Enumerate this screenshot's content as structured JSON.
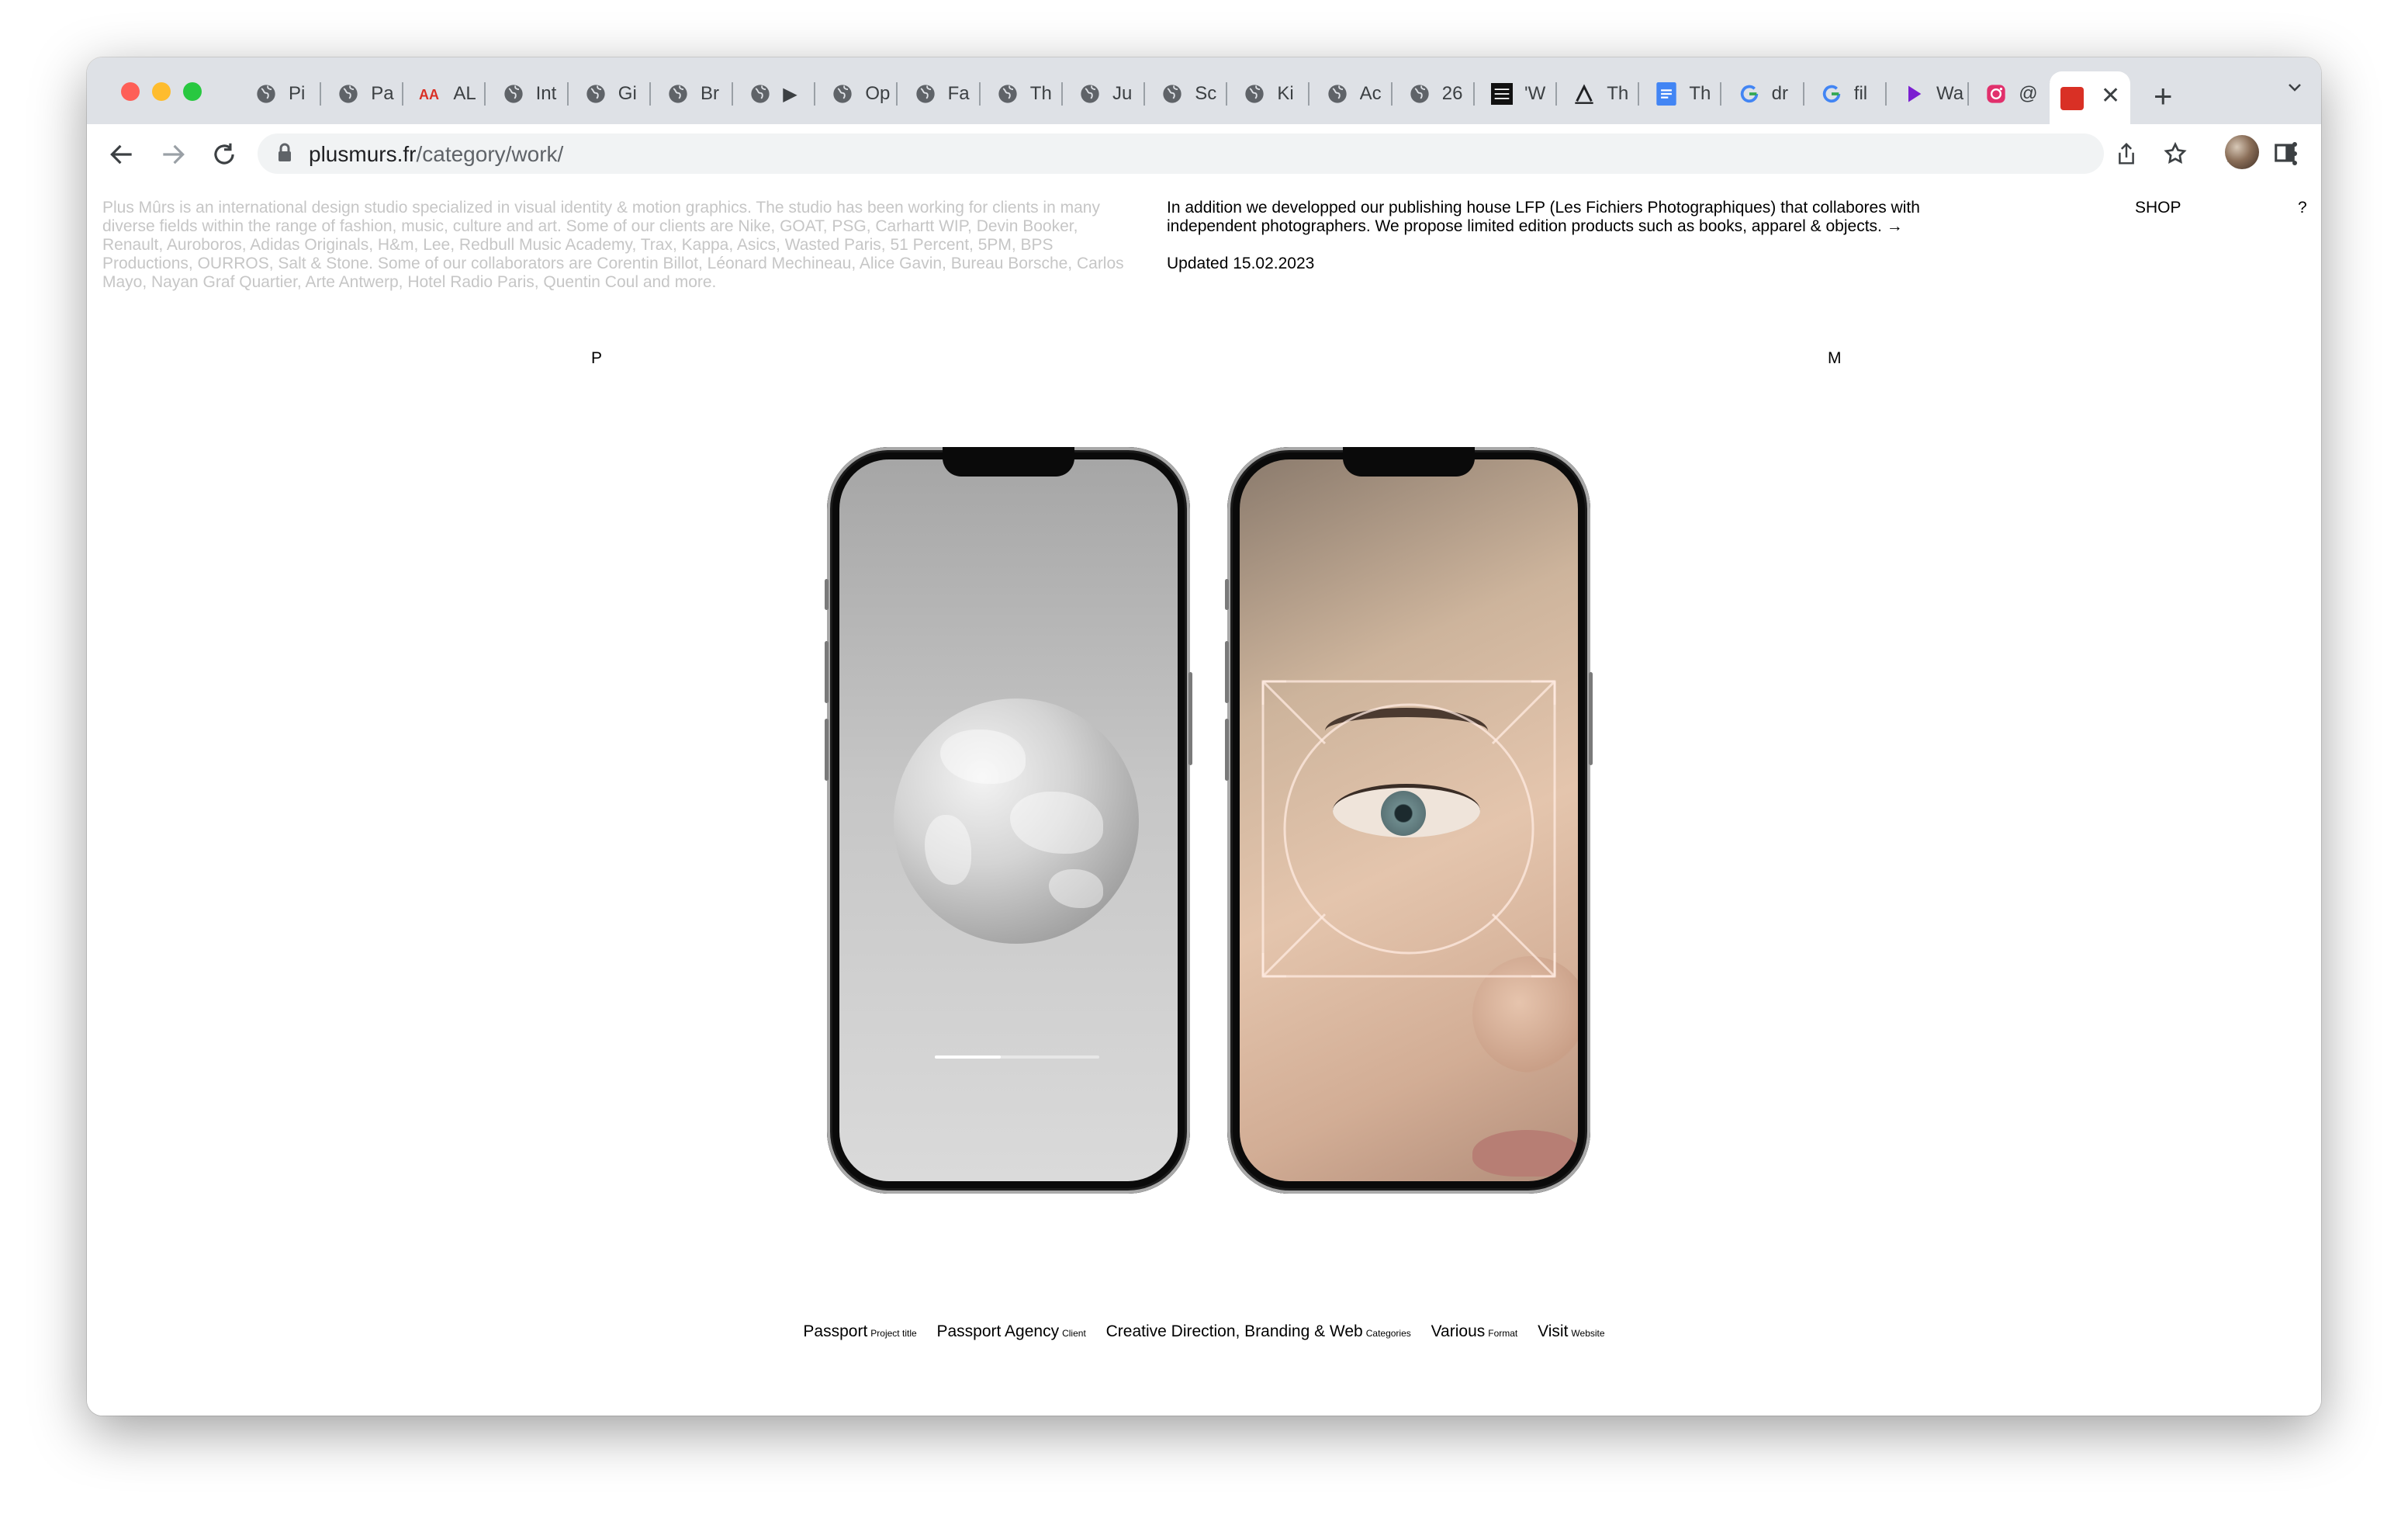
{
  "browser": {
    "tabs": [
      {
        "title": "Pi",
        "icon": "globe-icon"
      },
      {
        "title": "Pa",
        "icon": "globe-icon"
      },
      {
        "title": "AL",
        "icon": "aa-logo-icon"
      },
      {
        "title": "Int",
        "icon": "globe-icon"
      },
      {
        "title": "Gi",
        "icon": "globe-icon"
      },
      {
        "title": "Br",
        "icon": "globe-icon"
      },
      {
        "title": "▶",
        "icon": "globe-icon"
      },
      {
        "title": "Op",
        "icon": "globe-icon"
      },
      {
        "title": "Fa",
        "icon": "globe-icon"
      },
      {
        "title": "Th",
        "icon": "globe-icon"
      },
      {
        "title": "Ju",
        "icon": "globe-icon"
      },
      {
        "title": "Sc",
        "icon": "globe-icon"
      },
      {
        "title": "Ki",
        "icon": "globe-icon"
      },
      {
        "title": "Ac",
        "icon": "globe-icon"
      },
      {
        "title": "26",
        "icon": "globe-icon"
      },
      {
        "title": "'W",
        "icon": "sixth-tone-icon"
      },
      {
        "title": "Th",
        "icon": "a-logo-icon"
      },
      {
        "title": "Th",
        "icon": "google-docs-icon"
      },
      {
        "title": "dr",
        "icon": "google-icon"
      },
      {
        "title": "fil",
        "icon": "google-icon"
      },
      {
        "title": "Wa",
        "icon": "play-icon"
      },
      {
        "title": "@",
        "icon": "instagram-icon"
      }
    ],
    "active_tab": {
      "icon": "red-flag-icon",
      "close": "✕"
    },
    "new_tab": "+",
    "url_host": "plusmurs.fr",
    "url_path": "/category/work/"
  },
  "page": {
    "intro": "Plus Mûrs is an international design studio specialized in visual identity & motion graphics. The studio has been working for clients in many diverse fields within the range of fashion, music, culture and art. Some of our clients are Nike, GOAT, PSG, Carhartt WIP, Devin Booker, Renault, Auroboros, Adidas Originals, H&m, Lee, Redbull Music Academy, Trax, Kappa, Asics, Wasted Paris, 51 Percent, 5PM, BPS Productions, OURROS, Salt & Stone. Some of our collaborators are Corentin Billot, Léonard Mechineau, Alice Gavin, Bureau Borsche, Carlos Mayo, Nayan Graf Quartier, Arte Antwerp, Hotel Radio Paris, Quentin Coul and more.",
    "publishing": "In addition we developped our publishing house LFP (Les Fichiers Photographiques) that collabores with independent photographers. We propose limited edition products such as books, apparel & objects. →",
    "updated": "Updated 15.02.2023",
    "shop": "SHOP",
    "help": "?",
    "letter_left": "P",
    "letter_right": "M",
    "progress": 0.4,
    "project": {
      "title": "Passport",
      "title_label": "Project title",
      "client": "Passport Agency",
      "client_label": "Client",
      "categories": "Creative Direction, Branding & Web",
      "categories_label": "Categories",
      "format": "Various",
      "format_label": "Format",
      "visit": "Visit",
      "visit_label": "Website"
    }
  }
}
